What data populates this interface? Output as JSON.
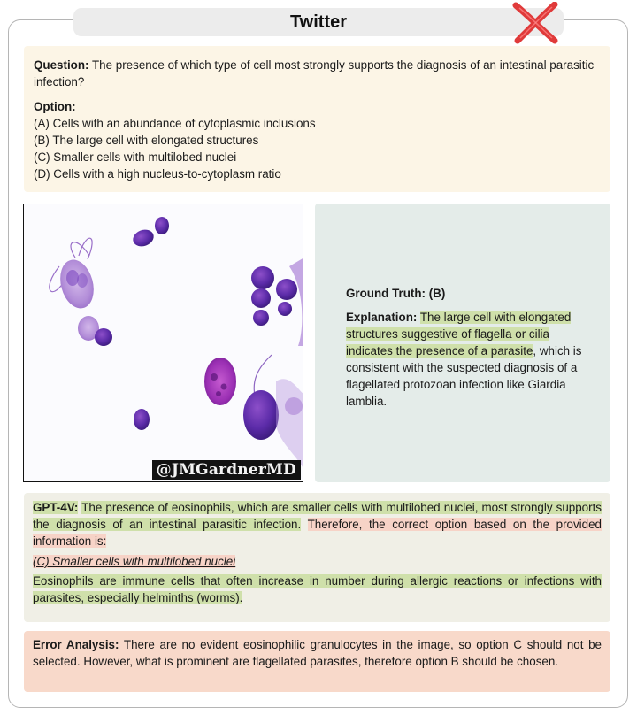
{
  "header": {
    "title": "Twitter",
    "verdict_icon": "red-x-icon",
    "verdict_color": "#e03a3a"
  },
  "question": {
    "label": "Question:",
    "text": "The presence of which type of cell most strongly supports the diagnosis of an intestinal parasitic infection?",
    "options_label": "Option:",
    "options": [
      "(A) Cells with an abundance of cytoplasmic inclusions",
      "(B) The large cell with elongated structures",
      "(C) Smaller cells with multilobed nuclei",
      "(D) Cells with a high nucleus-to-cytoplasm ratio"
    ]
  },
  "image": {
    "watermark": "@JMGardnerMD"
  },
  "ground_truth": {
    "label": "Ground Truth: (B)",
    "explanation_label": "Explanation:",
    "explanation_highlight": "The large cell with elongated structures suggestive of flagella or cilia indicates the presence of a parasite",
    "explanation_rest": ", which is consistent with the suspected diagnosis of a flagellated protozoan infection like Giardia lamblia."
  },
  "gpt4v": {
    "label": "GPT-4V:",
    "text_green_1": "The presence of eosinophils, which are smaller cells with multilobed nuclei, most strongly supports the diagnosis of an intestinal parasitic infection.",
    "text_red_1": "Therefore, the correct option based on the provided information is:",
    "answer": "(C) Smaller cells with multilobed nuclei",
    "text_green_2": "Eosinophils are immune cells that often increase in number during allergic reactions or infections with parasites, especially helminths (worms)."
  },
  "error_analysis": {
    "label": "Error Analysis:",
    "text": "There are no evident eosinophilic granulocytes in the image, so option C should not be selected. However, what is prominent are flagellated parasites, therefore option B should be chosen."
  },
  "colors": {
    "highlight_green": "#cfe0aa",
    "highlight_red": "#f7d3c7",
    "question_bg": "#fcf5e6",
    "truth_bg": "#e4ece9",
    "error_bg": "#f8d9ca"
  }
}
